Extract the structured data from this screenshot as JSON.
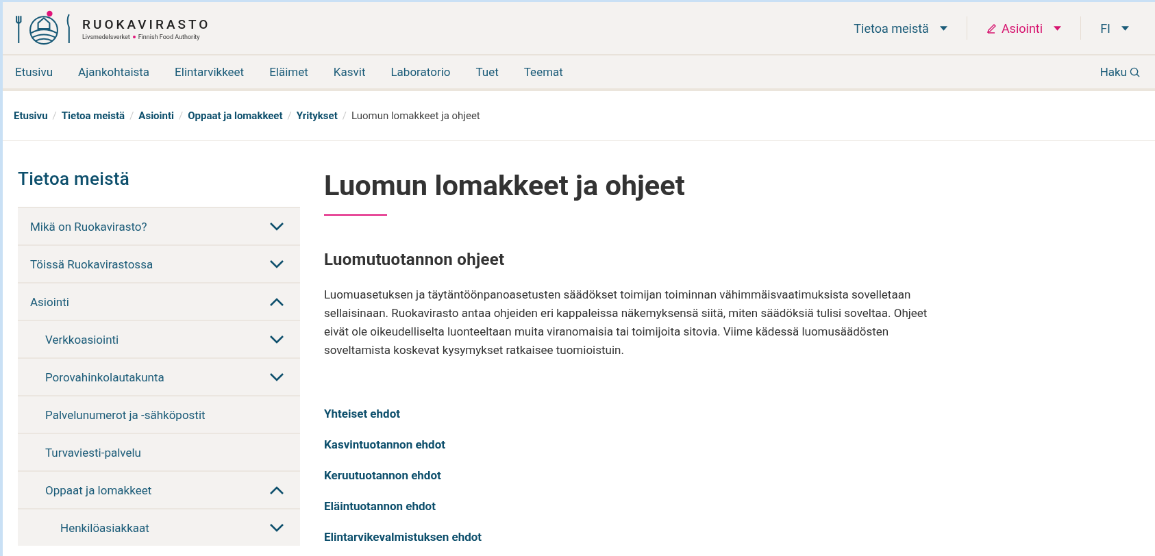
{
  "header": {
    "logo": {
      "name": "RUOKAVIRASTO",
      "tagline_left": "Livsmedelsverket",
      "tagline_right": "Finnish Food Authority"
    },
    "top_menu": [
      {
        "label": "Tietoa meistä",
        "kind": "dropdown"
      },
      {
        "label": "Asiointi",
        "kind": "service"
      },
      {
        "label": "FI",
        "kind": "dropdown"
      }
    ]
  },
  "nav": {
    "items": [
      "Etusivu",
      "Ajankohtaista",
      "Elintarvikkeet",
      "Eläimet",
      "Kasvit",
      "Laboratorio",
      "Tuet",
      "Teemat"
    ],
    "search": "Haku"
  },
  "breadcrumb": {
    "items": [
      {
        "kind": "link",
        "text": "Etusivu"
      },
      {
        "kind": "separator",
        "text": "/"
      },
      {
        "kind": "link",
        "text": "Tietoa meistä"
      },
      {
        "kind": "separator",
        "text": "/"
      },
      {
        "kind": "link",
        "text": "Asiointi"
      },
      {
        "kind": "separator",
        "text": "/"
      },
      {
        "kind": "link",
        "text": "Oppaat ja lomakkeet"
      },
      {
        "kind": "separator",
        "text": "/"
      },
      {
        "kind": "link",
        "text": "Yritykset"
      },
      {
        "kind": "separator",
        "text": "/"
      },
      {
        "kind": "current",
        "text": "Luomun lomakkeet ja ohjeet"
      }
    ]
  },
  "sidebar": {
    "title": "Tietoa meistä",
    "items": [
      {
        "label": "Mikä on Ruokavirasto?",
        "expanded": false
      },
      {
        "label": "Töissä Ruokavirastossa",
        "expanded": false
      },
      {
        "label": "Asiointi",
        "expanded": true,
        "children": [
          {
            "label": "Verkkoasiointi",
            "expanded": false
          },
          {
            "label": "Porovahinkolautakunta",
            "expanded": false
          },
          {
            "label": "Palvelunumerot ja -sähköpostit"
          },
          {
            "label": "Turvaviesti-palvelu"
          },
          {
            "label": "Oppaat ja lomakkeet",
            "expanded": true,
            "children": [
              {
                "label": "Henkilöasiakkaat",
                "expanded": false
              }
            ]
          }
        ]
      }
    ]
  },
  "main": {
    "title": "Luomun lomakkeet ja ohjeet",
    "heading": "Luomutuotannon ohjeet",
    "paragraph": "Luomuasetuksen ja täytäntöönpanoasetusten säädökset toimijan toiminnan vähimmäisvaatimuksista sovelletaan sellaisinaan. Ruokavirasto antaa ohjeiden eri kappaleissa näkemyksensä siitä, miten säädöksiä tulisi soveltaa. Ohjeet eivät ole oikeudelliselta luonteeltaan muita viranomaisia tai toimijoita sitovia. Viime kädessä luomusäädösten soveltamista koskevat kysymykset ratkaisee tuomioistuin.",
    "links": [
      "Yhteiset ehdot",
      "Kasvintuotannon ehdot",
      "Keruutuotannon ehdot",
      "Eläintuotannon ehdot",
      "Elintarvikevalmistuksen ehdot"
    ]
  }
}
